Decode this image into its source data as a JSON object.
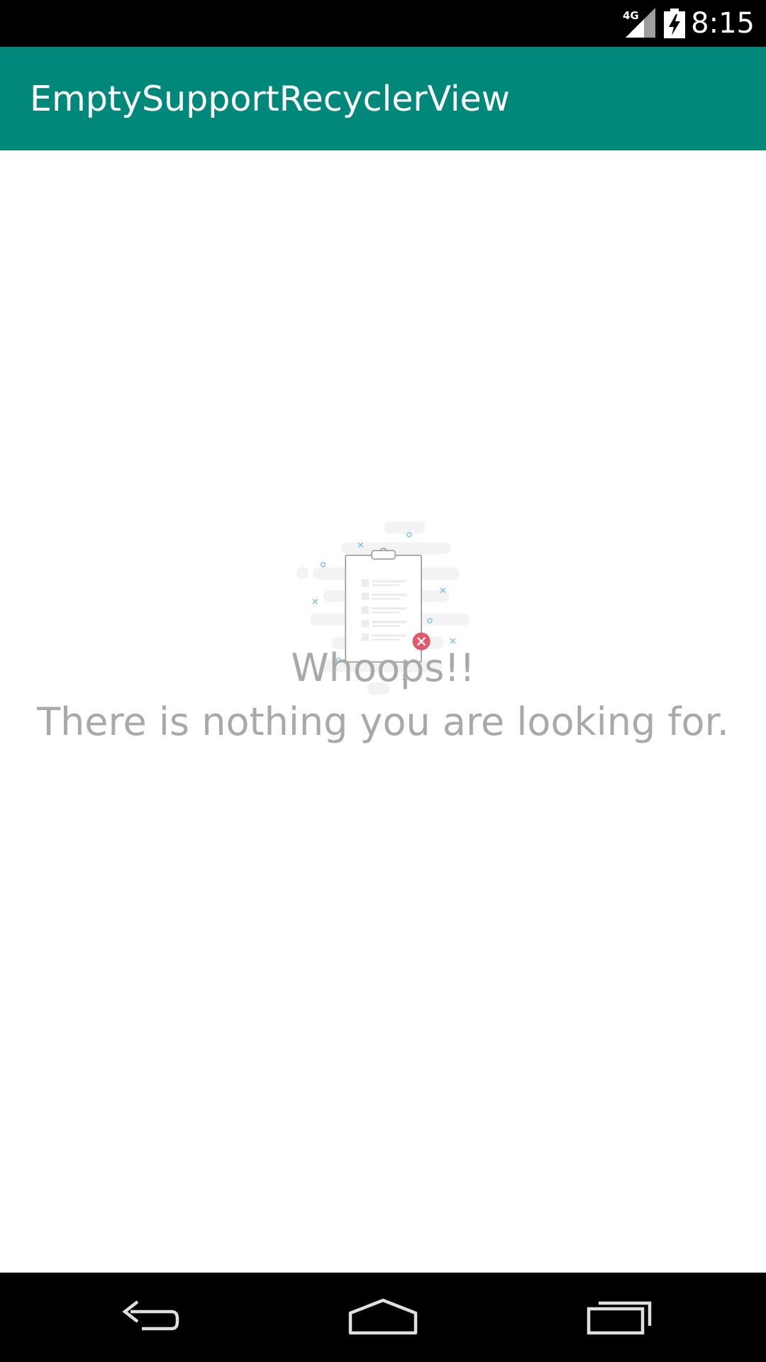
{
  "status_bar": {
    "network_label": "4G",
    "time": "8:15",
    "icons": [
      "signal-icon",
      "battery-charging-icon"
    ]
  },
  "app_bar": {
    "title": "EmptySupportRecyclerView",
    "color": "#00897b"
  },
  "empty_state": {
    "illustration": "empty-clipboard-icon",
    "title": "Whoops!!",
    "message": "There is nothing you are looking for.",
    "text_color": "#a9a9a9",
    "accent_color": "#e05a6d",
    "decoration_color": "#7ec8e3"
  },
  "nav_bar": {
    "icons": [
      "back-icon",
      "home-icon",
      "recents-icon"
    ]
  }
}
